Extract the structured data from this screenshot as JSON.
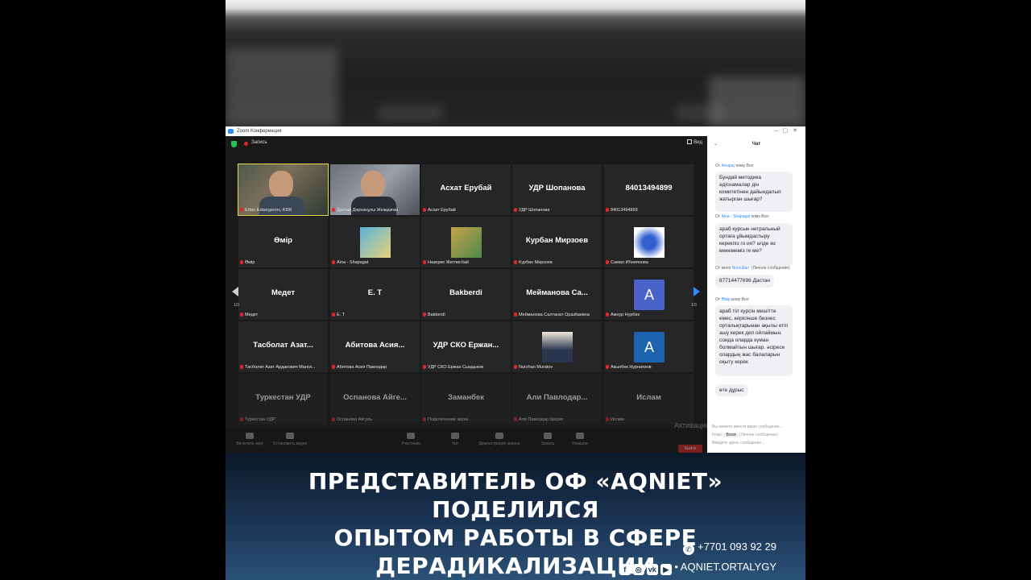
{
  "zoom": {
    "window_title": "Zoom Конференция",
    "recording_label": "Запись",
    "view_label": "Вид",
    "page_indicator_left": "1/3",
    "page_indicator_right": "1/3"
  },
  "tiles": [
    {
      "name": "",
      "caption": "Erfan Esbergenov, KDR",
      "kind": "video"
    },
    {
      "name": "",
      "caption": "Дастан Дәрханұлы Жезқазған",
      "kind": "video"
    },
    {
      "name": "Асхат Ерубай",
      "caption": "Асхат Ерубай",
      "kind": "text"
    },
    {
      "name": "УДР Шопанова",
      "caption": "УДР Шопанова",
      "kind": "text"
    },
    {
      "name": "84013494899",
      "caption": "84013494899",
      "kind": "text"
    },
    {
      "name": "Өмір",
      "caption": "Өмір",
      "kind": "text"
    },
    {
      "name": "",
      "caption": "Aina - Shapagat",
      "kind": "image"
    },
    {
      "name": "",
      "caption": "Назерке Жетписбай",
      "kind": "image"
    },
    {
      "name": "Курбан Мирзоев",
      "caption": "Курбан Мирзоев",
      "kind": "text"
    },
    {
      "name": "",
      "caption": "Самал Ибниянова",
      "kind": "image"
    },
    {
      "name": "Медет",
      "caption": "Медет",
      "kind": "text"
    },
    {
      "name": "Е. Т",
      "caption": "Е. Т",
      "kind": "text"
    },
    {
      "name": "Bakberdi",
      "caption": "Bakberdi",
      "kind": "text"
    },
    {
      "name": "Мейманова Са...",
      "caption": "Мейманова Салтанат Оразбаевна",
      "kind": "text"
    },
    {
      "name": "",
      "caption": "Ажнур Нурбек",
      "kind": "avatar",
      "letter": "A"
    },
    {
      "name": "Тасболат Азат...",
      "caption": "Тасболат Азат Ардакович Манги...",
      "kind": "text"
    },
    {
      "name": "Абитова Асия...",
      "caption": "Абитова Асия Павлодар",
      "kind": "text"
    },
    {
      "name": "УДР СКО Ержан...",
      "caption": "УДР СКО Ержан Сыздыков",
      "kind": "text"
    },
    {
      "name": "",
      "caption": "Nurzhan Muratov",
      "kind": "image"
    },
    {
      "name": "",
      "caption": "Акылбек Нурниязов",
      "kind": "avatar",
      "letter": "A"
    },
    {
      "name": "Туркестан УДР",
      "caption": "Туркестан УДР",
      "kind": "text"
    },
    {
      "name": "Оспанова Айге...",
      "caption": "Оспанова Айгуль",
      "kind": "text"
    },
    {
      "name": "Заманбек",
      "caption": "Подключение звука",
      "kind": "text"
    },
    {
      "name": "Али Павлодар...",
      "caption": "Али Павлодар Цюрих",
      "kind": "text"
    },
    {
      "name": "Ислам",
      "caption": "Ислам",
      "kind": "text"
    }
  ],
  "toolbar": [
    {
      "label": "Включить звук",
      "icon": "mic-icon"
    },
    {
      "label": "Остановить видео",
      "icon": "camera-icon"
    },
    {
      "label": "Участники",
      "icon": "participants-icon"
    },
    {
      "label": "Чат",
      "icon": "chat-icon"
    },
    {
      "label": "Демонстрация экрана",
      "icon": "share-screen-icon"
    },
    {
      "label": "Запись",
      "icon": "record-icon"
    },
    {
      "label": "Реакции",
      "icon": "reactions-icon"
    }
  ],
  "watermark": "Активация",
  "exit_label": "Выйти",
  "chat": {
    "title": "Чат",
    "messages": [
      {
        "from_prefix": "От",
        "sender": "Атырау",
        "to": "кому Все:",
        "text": "Бундай методика әдіснамалар дін комитетінен дайындалып жатырган шығар?"
      },
      {
        "from_prefix": "От",
        "sender": "Aina - Shapagat",
        "to": "кому Все:",
        "text": "араб курсын нетральный ортаға ұйымдастыру керекпіз го ия? әлде өз мекемеміз ге ме?"
      },
      {
        "from_prefix": "От меня",
        "sender": "Nursultan:",
        "to": "(Личное сообщение)",
        "text": "87714477696 Дастан"
      },
      {
        "from_prefix": "От",
        "sender": "Өмір",
        "to": "кому Все:",
        "text": "араб тіл курсін мешітте емес, керісінше бизнес орталықтарынан ақылы етіп ашу керек деп ойлаймын. сонда оларда күман болмайтын шығар. әсіресе олардың жас балаларын оқыту керек"
      },
      {
        "from_prefix": "",
        "sender": "",
        "to": "",
        "text": "өте дұрыс"
      }
    ],
    "input_hint": "Вы можете ввести ваше сообщение...",
    "to_label": "Кому:",
    "to_value": "Всем",
    "private_label": "(Личное сообщение)",
    "placeholder": "Введите здесь сообщение..."
  },
  "banner": {
    "headline_line1": "ПРЕДСТАВИТЕЛЬ ОФ «AQNIET» ПОДЕЛИЛСЯ",
    "headline_line2": "ОПЫТОМ РАБОТЫ В СФЕРЕ",
    "headline_line3": "ДЕРАДИКАЛИЗАЦИИ",
    "phone": "+7701 093 92 29",
    "site": "AQNIET.ORTALYGY"
  },
  "colors": {
    "accent": "#2d8cff",
    "record": "#e02828",
    "active_speaker": "#e2d84a",
    "avatar_blue": "#3f6fd0",
    "banner_dark": "#0b1828"
  }
}
